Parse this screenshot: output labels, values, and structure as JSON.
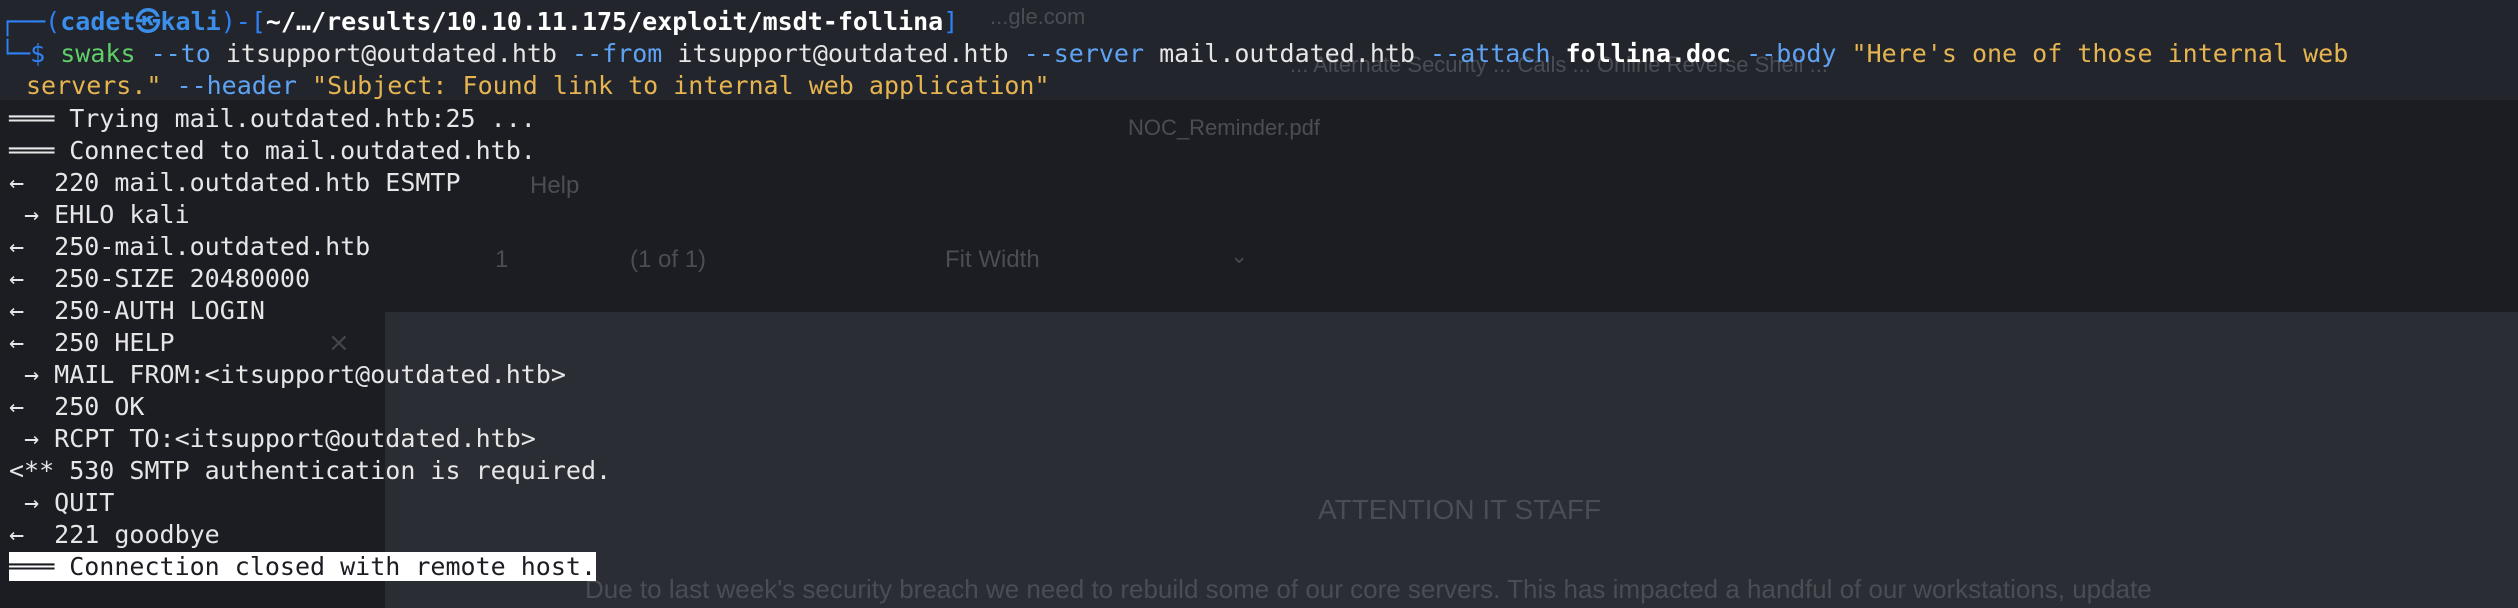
{
  "background_window": {
    "file_name": "NOC_Reminder.pdf",
    "help_label": "Help",
    "page_number": "1",
    "page_count": "(1 of 1)",
    "zoom": "Fit Width",
    "heading": "ATTENTION IT STAFF",
    "body_line": "Due to last week's security breach we need to rebuild some of our core servers. This has impacted a handful of our workstations, update",
    "top_left_url": "...gle.com",
    "top_mid": "... Alternate Security ... Calls ... Online Reverse Shell ...",
    "icons": [
      "close-icon",
      "chevron-down-icon"
    ]
  },
  "terminal": {
    "prompt": {
      "frame_top": "┌──(",
      "user": "cadet",
      "at": "㉿",
      "host": "kali",
      "mid": ")-[",
      "path": "~/…/results/10.10.11.175/exploit/msdt-follina",
      "end": "]",
      "frame_bottom": "└─",
      "dollar": "$"
    },
    "command": {
      "name": "swaks",
      "parts": [
        {
          "t": "flag",
          "v": "--to"
        },
        {
          "t": "arg",
          "v": "itsupport@outdated.htb"
        },
        {
          "t": "flag",
          "v": "--from"
        },
        {
          "t": "arg",
          "v": "itsupport@outdated.htb"
        },
        {
          "t": "flag",
          "v": "--server"
        },
        {
          "t": "arg",
          "v": "mail.outdated.htb"
        },
        {
          "t": "flag",
          "v": "--attach"
        },
        {
          "t": "bold",
          "v": "follina.doc"
        },
        {
          "t": "flag",
          "v": "--body"
        },
        {
          "t": "str",
          "v": "\"Here's one of those internal web"
        }
      ],
      "line2": [
        {
          "t": "str",
          "v": "servers.\""
        },
        {
          "t": "flag",
          "v": "--header"
        },
        {
          "t": "str",
          "v": "\"Subject: Found link to internal web application\""
        }
      ]
    },
    "output": [
      "=== Trying mail.outdated.htb:25 ...",
      "=== Connected to mail.outdated.htb.",
      "<-  220 mail.outdated.htb ESMTP",
      " -> EHLO kali",
      "<-  250-mail.outdated.htb",
      "<-  250-SIZE 20480000",
      "<-  250-AUTH LOGIN",
      "<-  250 HELP",
      " -> MAIL FROM:<itsupport@outdated.htb>",
      "<-  250 OK",
      " -> RCPT TO:<itsupport@outdated.htb>",
      "<** 530 SMTP authentication is required.",
      " -> QUIT",
      "<-  221 goodbye"
    ],
    "output_display": [
      "═══ Trying mail.outdated.htb:25 ...",
      "═══ Connected to mail.outdated.htb.",
      "←  220 mail.outdated.htb ESMTP",
      " → EHLO kali",
      "←  250-mail.outdated.htb",
      "←  250-SIZE 20480000",
      "←  250-AUTH LOGIN",
      "←  250 HELP",
      " → MAIL FROM:<itsupport@outdated.htb>",
      "←  250 OK",
      " → RCPT TO:<itsupport@outdated.htb>",
      "<** 530 SMTP authentication is required.",
      " → QUIT",
      "←  221 goodbye"
    ],
    "final_line": "═══ Connection closed with remote host."
  }
}
